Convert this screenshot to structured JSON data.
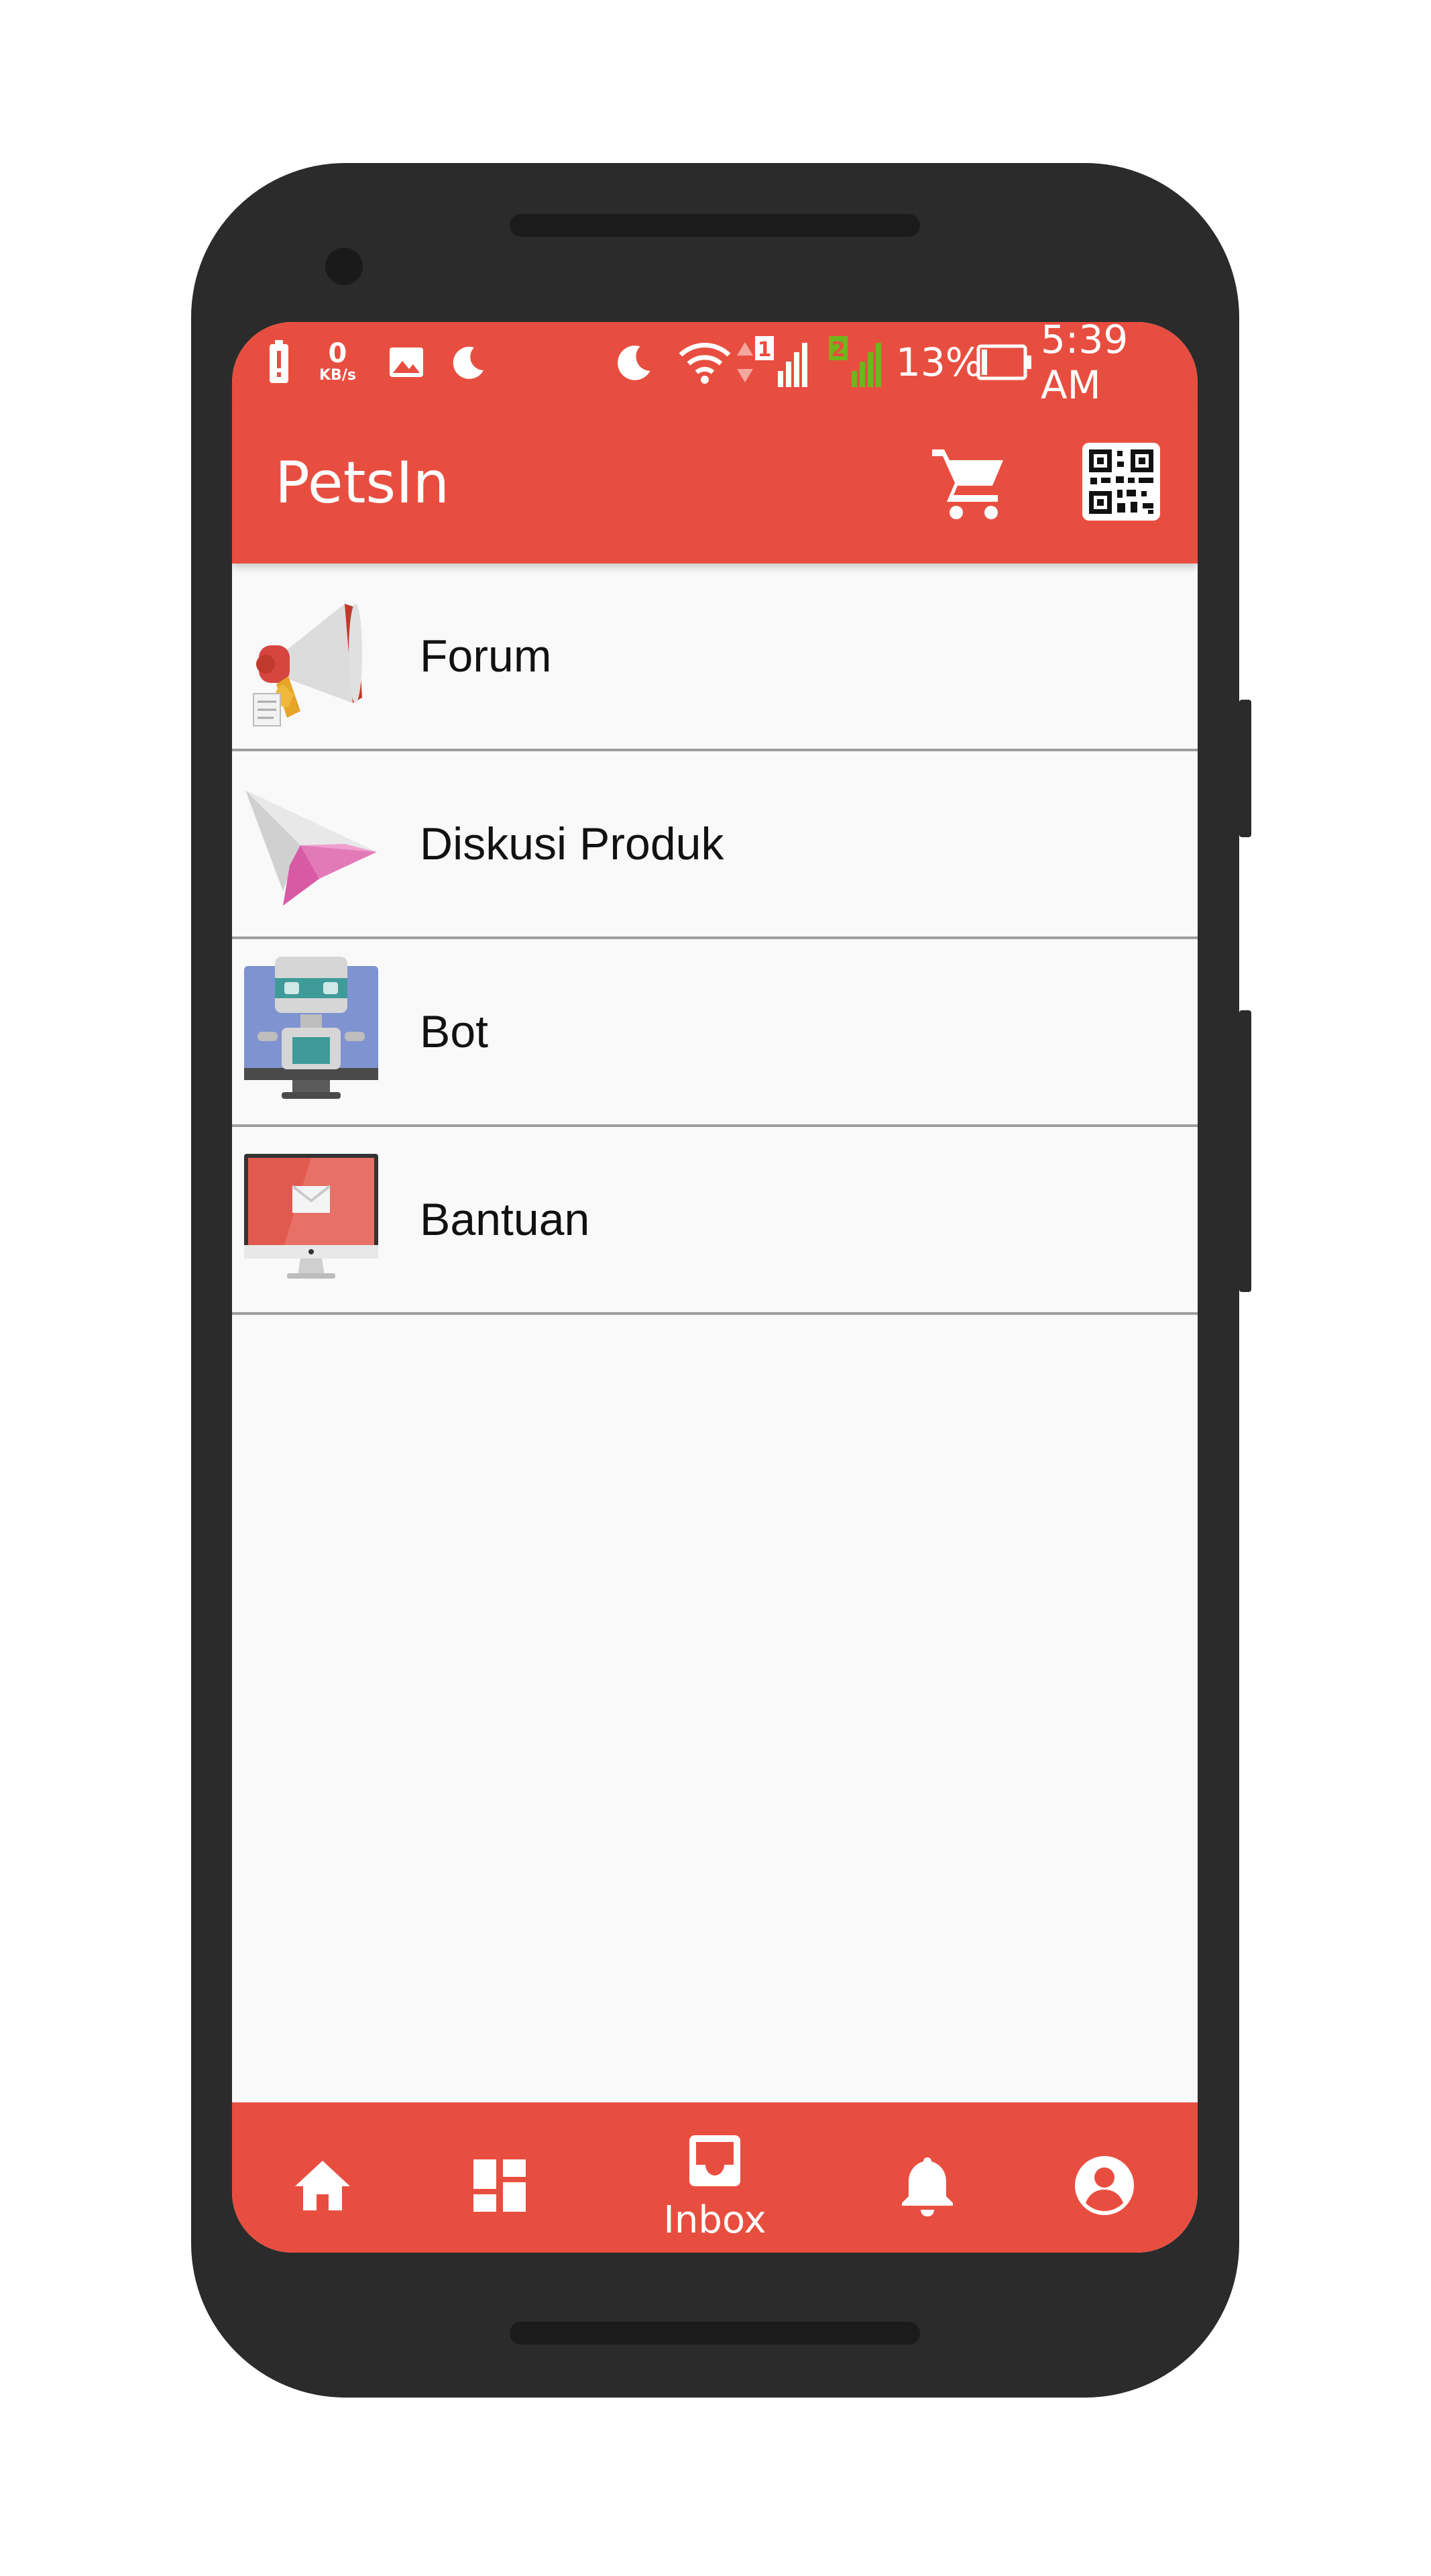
{
  "status_bar": {
    "net_speed_value": "0",
    "net_speed_unit": "KB/s",
    "battery_percent": "13%",
    "time": "5:39 AM",
    "sim1_label": "1",
    "sim2_label": "2"
  },
  "toolbar": {
    "title": "PetsIn",
    "cart_icon": "shopping-cart-icon",
    "qr_icon": "qr-code-icon"
  },
  "inbox_list": [
    {
      "label": "Forum",
      "icon": "megaphone-icon"
    },
    {
      "label": "Diskusi Produk",
      "icon": "paper-plane-icon"
    },
    {
      "label": "Bot",
      "icon": "robot-icon"
    },
    {
      "label": "Bantuan",
      "icon": "monitor-mail-icon"
    }
  ],
  "bottom_nav": {
    "active": "inbox",
    "inbox_label": "Inbox",
    "items": [
      "home-icon",
      "dashboard-icon",
      "inbox-icon",
      "bell-icon",
      "account-icon"
    ]
  },
  "system_nav": [
    "back-icon",
    "home-outline-icon",
    "recents-icon"
  ],
  "colors": {
    "brand": "#e84e40",
    "list_background": "#f9f9f9",
    "divider": "#9e9e9e",
    "phone_body": "#2b2b2b"
  }
}
